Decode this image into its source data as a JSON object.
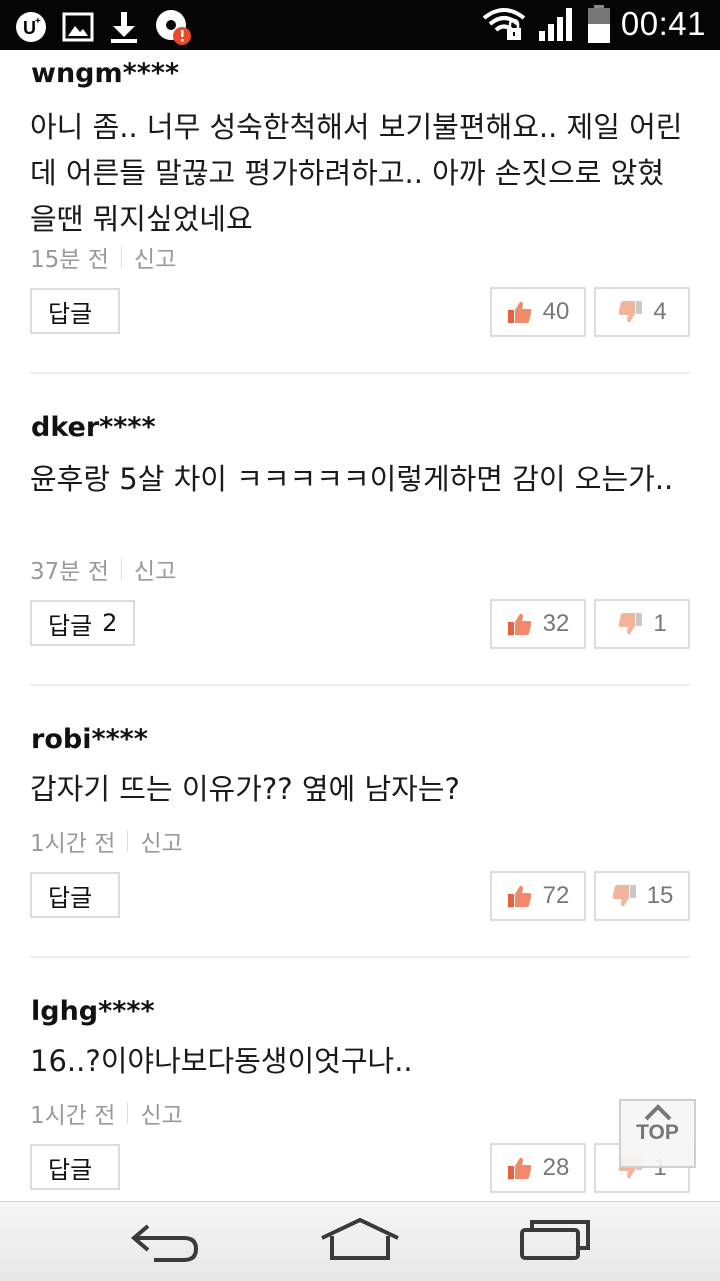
{
  "status_bar": {
    "time": "00:41",
    "icons": [
      "uplus-icon",
      "image-icon",
      "download-icon",
      "media-alert-icon",
      "wifi-lock-icon",
      "signal-icon",
      "battery-icon"
    ]
  },
  "comments": [
    {
      "author": "wngm****",
      "text": "아니 좀.. 너무 성숙한척해서 보기불편해요.. 제일 어린데 어른들 말끊고 평가하려하고.. 아까 손짓으로 앉혔을땐 뭐지싶었네요",
      "time": "15분 전",
      "report": "신고",
      "reply_label": "답글",
      "reply_count": "",
      "likes": "40",
      "dislikes": "4"
    },
    {
      "author": "dker****",
      "text": "윤후랑 5살 차이 ㅋㅋㅋㅋㅋ이렇게하면 감이 오는가..",
      "time": "37분 전",
      "report": "신고",
      "reply_label": "답글",
      "reply_count": "2",
      "likes": "32",
      "dislikes": "1"
    },
    {
      "author": "robi****",
      "text": "갑자기 뜨는 이유가?? 옆에 남자는?",
      "time": "1시간 전",
      "report": "신고",
      "reply_label": "답글",
      "reply_count": "",
      "likes": "72",
      "dislikes": "15"
    },
    {
      "author": "lghg****",
      "text": "16..?이야나보다동생이엇구나..",
      "time": "1시간 전",
      "report": "신고",
      "reply_label": "답글",
      "reply_count": "",
      "likes": "28",
      "dislikes": "1"
    }
  ],
  "top_button": {
    "label": "TOP"
  },
  "colors": {
    "like": "#e8603c",
    "dislike": "#e8a080",
    "border": "#dcdcdc",
    "meta": "#999999"
  }
}
